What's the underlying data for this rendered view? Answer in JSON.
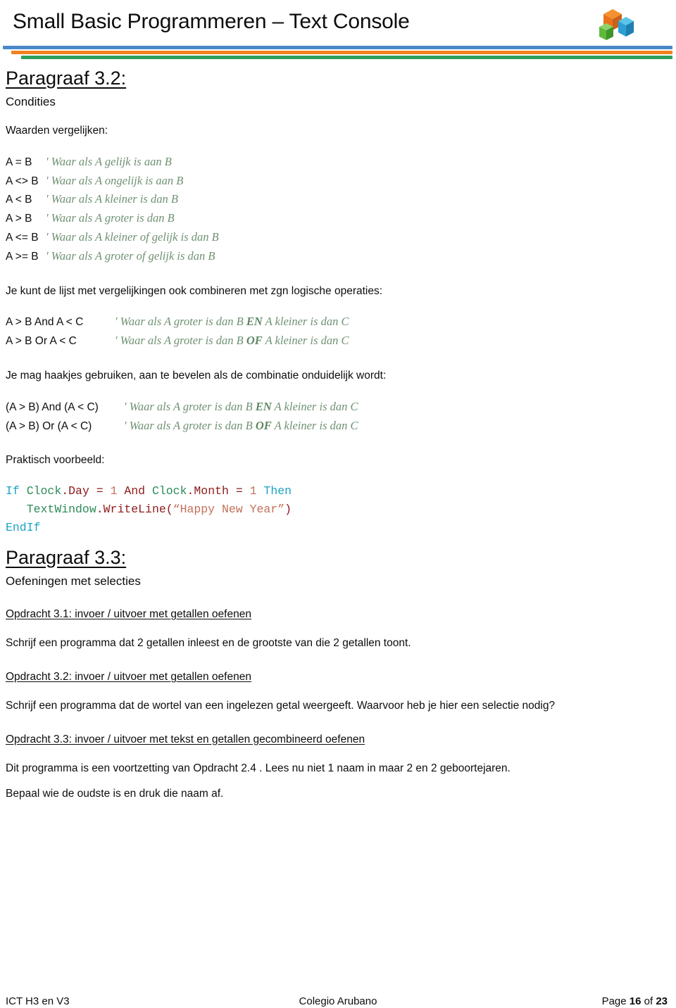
{
  "header": {
    "title": "Small Basic Programmeren – Text Console",
    "logo_icon": "small-basic-cubes-logo",
    "rule_colors": {
      "blue": "#4A89C8",
      "orange": "#F0811F",
      "green": "#2CA05A"
    }
  },
  "paragraph_32": {
    "heading": "Paragraaf 3.2:",
    "subtitle": "Condities",
    "intro": "Waarden vergelijken:",
    "comparison_operators": [
      {
        "expr": "A = B",
        "comment": "' Waar als A gelijk is aan B"
      },
      {
        "expr": "A <> B",
        "comment": "' Waar als A ongelijk is aan B"
      },
      {
        "expr": "A < B",
        "comment": "' Waar als A kleiner is dan B"
      },
      {
        "expr": "A > B",
        "comment": "' Waar als A groter is dan B"
      },
      {
        "expr": "A <= B",
        "comment": "' Waar als A kleiner of gelijk is dan B"
      },
      {
        "expr": "A >= B",
        "comment": "' Waar als A groter of gelijk is dan B"
      }
    ],
    "logic_intro": "Je kunt de lijst met vergelijkingen ook combineren met zgn logische operaties:",
    "logic_operators": [
      {
        "expr": "A > B And A < C",
        "comment_pre": "' Waar als A groter is dan B ",
        "comment_bold": "EN",
        "comment_post": " A kleiner is dan C"
      },
      {
        "expr": "A > B Or A < C",
        "comment_pre": " ' Waar als A groter is dan B ",
        "comment_bold": "OF",
        "comment_post": " A kleiner is dan C"
      }
    ],
    "paren_intro": "Je mag haakjes gebruiken, aan te bevelen als de combinatie onduidelijk wordt:",
    "paren_operators": [
      {
        "expr": "(A > B) And (A < C)",
        "comment_pre": "' Waar als A groter is dan B ",
        "comment_bold": "EN",
        "comment_post": " A kleiner is dan C"
      },
      {
        "expr": "(A > B) Or (A < C)",
        "comment_pre": " ' Waar als A groter is dan B ",
        "comment_bold": "OF",
        "comment_post": " A kleiner is dan C"
      }
    ],
    "example_label": "Praktisch voorbeeld:",
    "code": {
      "line1": {
        "if": "If",
        "obj1": " Clock",
        "mem1": ".Day",
        "eq1": " = ",
        "num1": "1",
        "and": " And",
        "obj2": " Clock",
        "mem2": ".Month",
        "eq2": " = ",
        "num2": "1",
        "then": " Then"
      },
      "line2": {
        "indent": "   ",
        "obj": "TextWindow",
        "mem": ".WriteLine(",
        "string": "“Happy New Year”",
        "close": ")"
      },
      "line3": {
        "endif": "EndIf"
      }
    },
    "code_colors": {
      "keyword": "#1CA3C4",
      "object": "#2E8B57",
      "member": "#8E1B1B",
      "number": "#C4705A",
      "string": "#C4705A"
    }
  },
  "paragraph_33": {
    "heading": "Paragraaf 3.3:",
    "subtitle": "Oefeningen met selecties",
    "assignments": [
      {
        "title": "Opdracht 3.1: invoer / uitvoer met getallen oefenen",
        "body": [
          "Schrijf een programma dat 2 getallen inleest en de grootste van die 2 getallen toont."
        ]
      },
      {
        "title": "Opdracht 3.2: invoer / uitvoer met getallen oefenen",
        "body": [
          "Schrijf een programma dat de wortel van een ingelezen getal weergeeft. Waarvoor heb je hier een selectie nodig?"
        ]
      },
      {
        "title": "Opdracht 3.3: invoer / uitvoer met tekst en getallen gecombineerd oefenen",
        "body": [
          "Dit programma is een voortzetting van Opdracht 2.4 . Lees nu niet 1 naam in maar 2 en 2 geboortejaren.",
          "Bepaal wie de oudste is en druk die naam af."
        ]
      }
    ]
  },
  "footer": {
    "left": "ICT H3 en V3",
    "center": "Colegio Arubano",
    "page_prefix": "Page ",
    "page_number": "16",
    "page_middle": " of ",
    "page_total": "23"
  }
}
